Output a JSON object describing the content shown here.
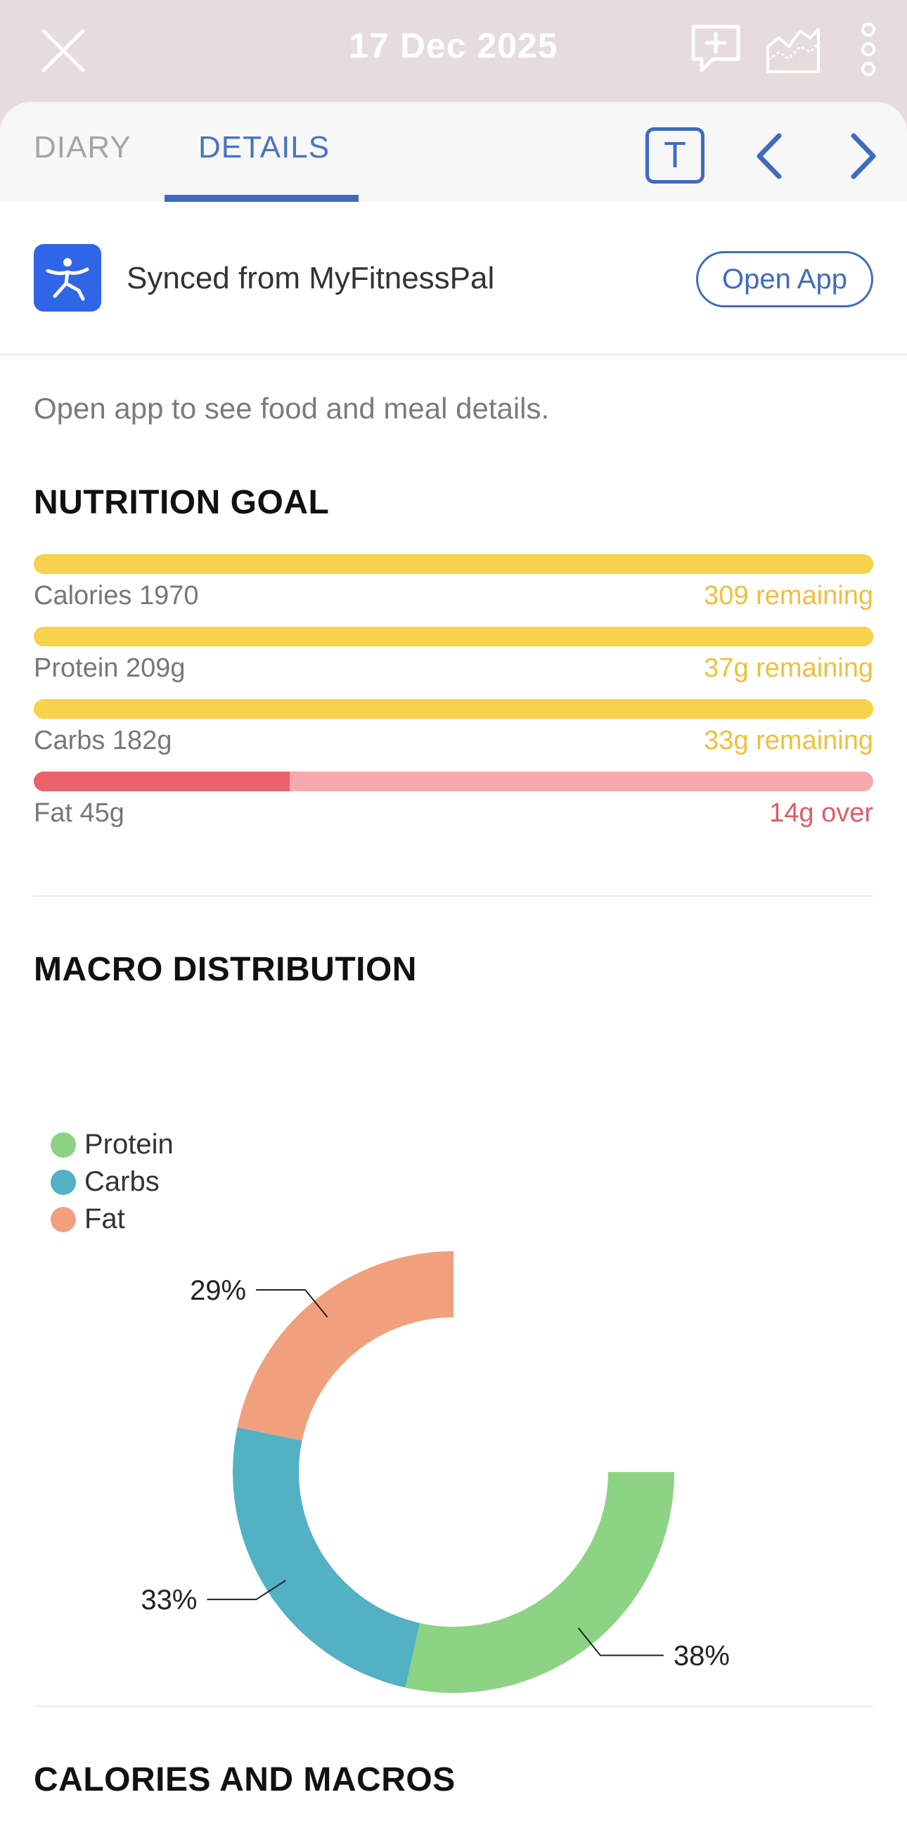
{
  "header": {
    "date": "17 Dec 2025",
    "icons": {
      "close": "close-icon",
      "comment": "comment-add-icon",
      "trend": "trend-chart-icon",
      "more": "more-vertical-icon"
    }
  },
  "tabs": {
    "diary": "DIARY",
    "details": "DETAILS",
    "text_toggle": "T",
    "prev_icon": "chevron-left-icon",
    "next_icon": "chevron-right-icon"
  },
  "sync": {
    "text": "Synced from MyFitnessPal",
    "open_label": "Open App",
    "logo_icon": "myfitnesspal-logo"
  },
  "hint": "Open app to see food and meal details.",
  "nutrition_goal": {
    "heading": "NUTRITION GOAL",
    "rows": [
      {
        "label": "Calories 1970",
        "status": "309 remaining",
        "fill_fraction": 1.0,
        "over": false
      },
      {
        "label": "Protein 209g",
        "status": "37g remaining",
        "fill_fraction": 1.0,
        "over": false
      },
      {
        "label": "Carbs 182g",
        "status": "33g remaining",
        "fill_fraction": 1.0,
        "over": false
      },
      {
        "label": "Fat 45g",
        "status": "14g over",
        "fill_fraction": 0.305,
        "over": true
      }
    ]
  },
  "macro": {
    "heading": "MACRO DISTRIBUTION",
    "legend": [
      {
        "label": "Protein",
        "color": "#8cd383"
      },
      {
        "label": "Carbs",
        "color": "#52b1c3"
      },
      {
        "label": "Fat",
        "color": "#f1a07d"
      }
    ]
  },
  "calories_heading": "CALORIES AND MACROS",
  "chart_data": {
    "type": "pie",
    "categories": [
      "Protein",
      "Carbs",
      "Fat"
    ],
    "values": [
      38,
      33,
      29
    ],
    "value_labels": [
      "38%",
      "33%",
      "29%"
    ],
    "colors": [
      "#8cd383",
      "#52b1c3",
      "#f1a07d"
    ],
    "legend_position": "top-left"
  }
}
